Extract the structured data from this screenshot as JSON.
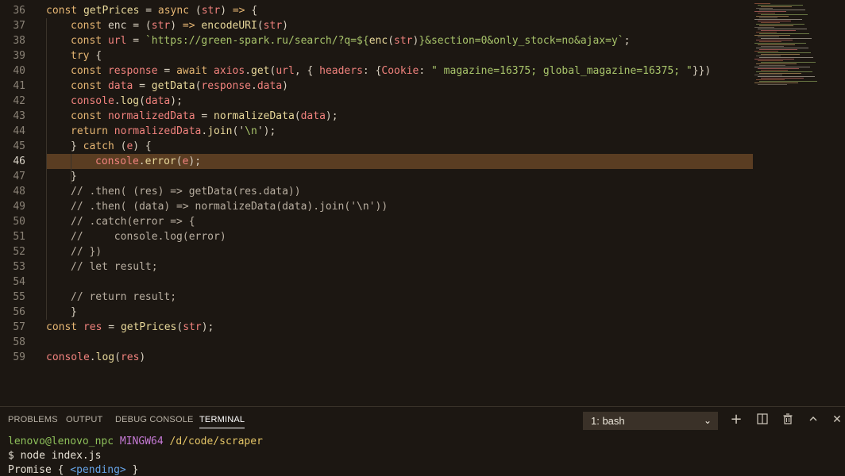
{
  "editor": {
    "active_line": 46,
    "lines": [
      {
        "n": "36",
        "indent": 0,
        "segs": [
          [
            "kw",
            "const "
          ],
          [
            "fn",
            "getPrices"
          ],
          [
            "op",
            " = "
          ],
          [
            "kw",
            "async "
          ],
          [
            "op",
            "("
          ],
          [
            "var",
            "str"
          ],
          [
            "op",
            ") "
          ],
          [
            "kw",
            "=> "
          ],
          [
            "op",
            "{"
          ]
        ]
      },
      {
        "n": "37",
        "indent": 1,
        "segs": [
          [
            "kw",
            "const "
          ],
          [
            "op",
            "enc = ("
          ],
          [
            "var",
            "str"
          ],
          [
            "op",
            ") "
          ],
          [
            "kw",
            "=> "
          ],
          [
            "fn",
            "encodeURI"
          ],
          [
            "op",
            "("
          ],
          [
            "var",
            "str"
          ],
          [
            "op",
            ")"
          ]
        ]
      },
      {
        "n": "38",
        "indent": 1,
        "segs": [
          [
            "kw",
            "const "
          ],
          [
            "var",
            "url"
          ],
          [
            "op",
            " = "
          ],
          [
            "str",
            "`https://green-spark.ru/search/?q=${"
          ],
          [
            "fn",
            "enc"
          ],
          [
            "op",
            "("
          ],
          [
            "var",
            "str"
          ],
          [
            "op",
            ")"
          ],
          [
            "str",
            "}&section=0&only_stock=no&ajax=y`"
          ],
          [
            "op",
            ";"
          ]
        ]
      },
      {
        "n": "39",
        "indent": 1,
        "segs": [
          [
            "kw",
            "try "
          ],
          [
            "op",
            "{"
          ]
        ]
      },
      {
        "n": "40",
        "indent": 1,
        "segs": [
          [
            "kw",
            "const "
          ],
          [
            "var",
            "response"
          ],
          [
            "op",
            " = "
          ],
          [
            "kw",
            "await "
          ],
          [
            "var",
            "axios"
          ],
          [
            "op",
            "."
          ],
          [
            "fn",
            "get"
          ],
          [
            "op",
            "("
          ],
          [
            "var",
            "url"
          ],
          [
            "op",
            ", { "
          ],
          [
            "var",
            "headers"
          ],
          [
            "op",
            ": {"
          ],
          [
            "var",
            "Cookie"
          ],
          [
            "op",
            ": "
          ],
          [
            "str",
            "\" magazine=16375; global_magazine=16375; \""
          ],
          [
            "op",
            "}})"
          ]
        ]
      },
      {
        "n": "41",
        "indent": 1,
        "segs": [
          [
            "kw",
            "const "
          ],
          [
            "var",
            "data"
          ],
          [
            "op",
            " = "
          ],
          [
            "fn",
            "getData"
          ],
          [
            "op",
            "("
          ],
          [
            "var",
            "response"
          ],
          [
            "op",
            "."
          ],
          [
            "var",
            "data"
          ],
          [
            "op",
            ")"
          ]
        ]
      },
      {
        "n": "42",
        "indent": 1,
        "segs": [
          [
            "var",
            "console"
          ],
          [
            "op",
            "."
          ],
          [
            "fn",
            "log"
          ],
          [
            "op",
            "("
          ],
          [
            "var",
            "data"
          ],
          [
            "op",
            ");"
          ]
        ]
      },
      {
        "n": "43",
        "indent": 1,
        "segs": [
          [
            "kw",
            "const "
          ],
          [
            "var",
            "normalizedData"
          ],
          [
            "op",
            " = "
          ],
          [
            "fn",
            "normalizeData"
          ],
          [
            "op",
            "("
          ],
          [
            "var",
            "data"
          ],
          [
            "op",
            ");"
          ]
        ]
      },
      {
        "n": "44",
        "indent": 1,
        "segs": [
          [
            "kw",
            "return "
          ],
          [
            "var",
            "normalizedData"
          ],
          [
            "op",
            "."
          ],
          [
            "fn",
            "join"
          ],
          [
            "op",
            "('"
          ],
          [
            "str",
            "\\n"
          ],
          [
            "op",
            "');"
          ]
        ]
      },
      {
        "n": "45",
        "indent": 1,
        "segs": [
          [
            "op",
            "} "
          ],
          [
            "kw",
            "catch "
          ],
          [
            "op",
            "("
          ],
          [
            "var",
            "e"
          ],
          [
            "op",
            ") {"
          ]
        ]
      },
      {
        "n": "46",
        "indent": 2,
        "segs": [
          [
            "var",
            "console"
          ],
          [
            "op",
            "."
          ],
          [
            "fn",
            "error"
          ],
          [
            "op",
            "("
          ],
          [
            "var",
            "e"
          ],
          [
            "op",
            ");"
          ]
        ]
      },
      {
        "n": "47",
        "indent": 1,
        "segs": [
          [
            "op",
            "}"
          ]
        ]
      },
      {
        "n": "48",
        "indent": 1,
        "segs": [
          [
            "cm",
            "// .then( (res) => getData(res.data))"
          ]
        ]
      },
      {
        "n": "49",
        "indent": 1,
        "segs": [
          [
            "cm",
            "// .then( (data) => normalizeData(data).join('\\n'))"
          ]
        ]
      },
      {
        "n": "50",
        "indent": 1,
        "segs": [
          [
            "cm",
            "// .catch(error => {"
          ]
        ]
      },
      {
        "n": "51",
        "indent": 1,
        "segs": [
          [
            "cm",
            "//     console.log(error)"
          ]
        ]
      },
      {
        "n": "52",
        "indent": 1,
        "segs": [
          [
            "cm",
            "// })"
          ]
        ]
      },
      {
        "n": "53",
        "indent": 1,
        "segs": [
          [
            "cm",
            "// let result;"
          ]
        ]
      },
      {
        "n": "54",
        "indent": 0,
        "segs": []
      },
      {
        "n": "55",
        "indent": 1,
        "segs": [
          [
            "cm",
            "// return result;"
          ]
        ]
      },
      {
        "n": "56",
        "indent": 1,
        "segs": [
          [
            "op",
            "}"
          ]
        ]
      },
      {
        "n": "57",
        "indent": 0,
        "segs": [
          [
            "kw",
            "const "
          ],
          [
            "var",
            "res"
          ],
          [
            "op",
            " = "
          ],
          [
            "fn",
            "getPrices"
          ],
          [
            "op",
            "("
          ],
          [
            "var",
            "str"
          ],
          [
            "op",
            ");"
          ]
        ]
      },
      {
        "n": "58",
        "indent": 0,
        "segs": []
      },
      {
        "n": "59",
        "indent": 0,
        "segs": [
          [
            "var",
            "console"
          ],
          [
            "op",
            "."
          ],
          [
            "fn",
            "log"
          ],
          [
            "op",
            "("
          ],
          [
            "var",
            "res"
          ],
          [
            "op",
            ")"
          ]
        ]
      }
    ]
  },
  "panel": {
    "tabs": [
      "PROBLEMS",
      "OUTPUT",
      "DEBUG CONSOLE",
      "TERMINAL"
    ],
    "active_tab": "TERMINAL",
    "terminal_select": "1: bash",
    "icons": {
      "add": "+",
      "split": "◫",
      "trash": "🗑",
      "maximize": "⌃",
      "close": "✕"
    }
  },
  "terminal": {
    "user": "lenovo@lenovo_npc",
    "system": "MINGW64",
    "path": "/d/code/scraper",
    "command": "$ node index.js",
    "output_prefix": "Promise { ",
    "output_pending": "<pending>",
    "output_suffix": " }"
  },
  "colors": {
    "background": "#1c1712",
    "highlight": "#5a3d22",
    "keyword": "#e6b673",
    "string": "#a8c46b",
    "variable": "#f0827d"
  }
}
